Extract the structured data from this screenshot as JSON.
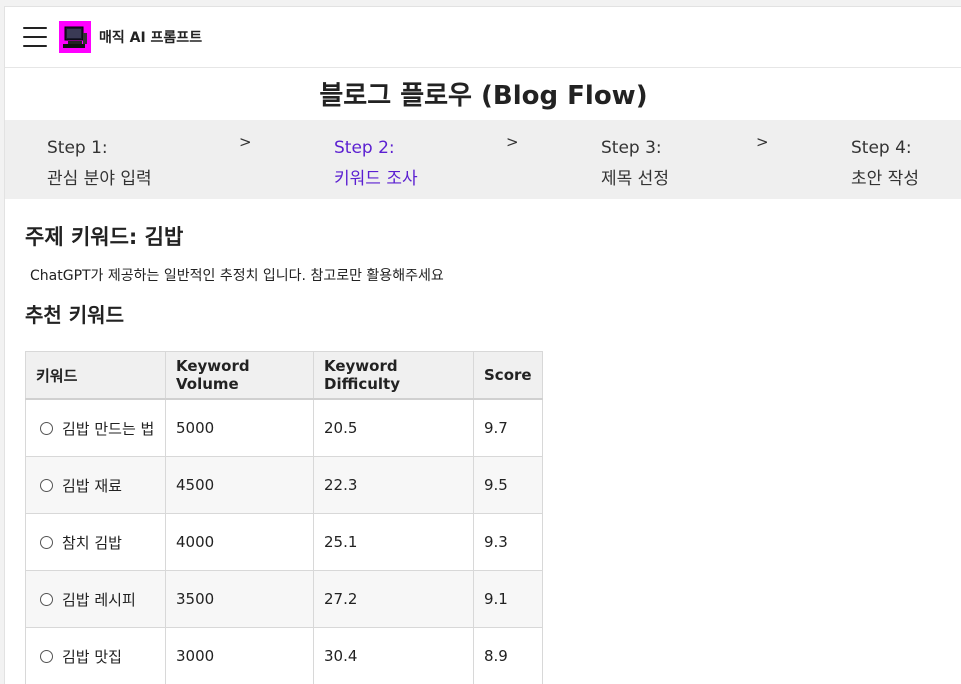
{
  "header": {
    "menu_icon": "hamburger-menu-icon",
    "logo_icon": "computer-logo-icon",
    "brand_color": "#ff00ff",
    "app_name": "매직 AI 프롬프트"
  },
  "page_title": "블로그 플로우 (Blog Flow)",
  "steps": [
    {
      "step": "Step 1:",
      "label": "관심 분야 입력",
      "active": false
    },
    {
      "step": "Step 2:",
      "label": "키워드 조사",
      "active": true
    },
    {
      "step": "Step 3:",
      "label": "제목 선정",
      "active": false
    },
    {
      "step": "Step 4:",
      "label": "초안 작성",
      "active": false
    }
  ],
  "step_separator": ">",
  "active_color": "#5b1fd1",
  "topic": {
    "title": "주제 키워드: 김밥",
    "note": "ChatGPT가 제공하는 일반적인 추정치 입니다. 참고로만 활용해주세요"
  },
  "recommend": {
    "title": "추천 키워드",
    "columns": [
      "키워드",
      "Keyword Volume",
      "Keyword Difficulty",
      "Score"
    ],
    "rows": [
      {
        "keyword": "김밥 만드는 법",
        "volume": "5000",
        "difficulty": "20.5",
        "score": "9.7"
      },
      {
        "keyword": "김밥 재료",
        "volume": "4500",
        "difficulty": "22.3",
        "score": "9.5"
      },
      {
        "keyword": "참치 김밥",
        "volume": "4000",
        "difficulty": "25.1",
        "score": "9.3"
      },
      {
        "keyword": "김밥 레시피",
        "volume": "3500",
        "difficulty": "27.2",
        "score": "9.1"
      },
      {
        "keyword": "김밥 맛집",
        "volume": "3000",
        "difficulty": "30.4",
        "score": "8.9"
      }
    ]
  }
}
